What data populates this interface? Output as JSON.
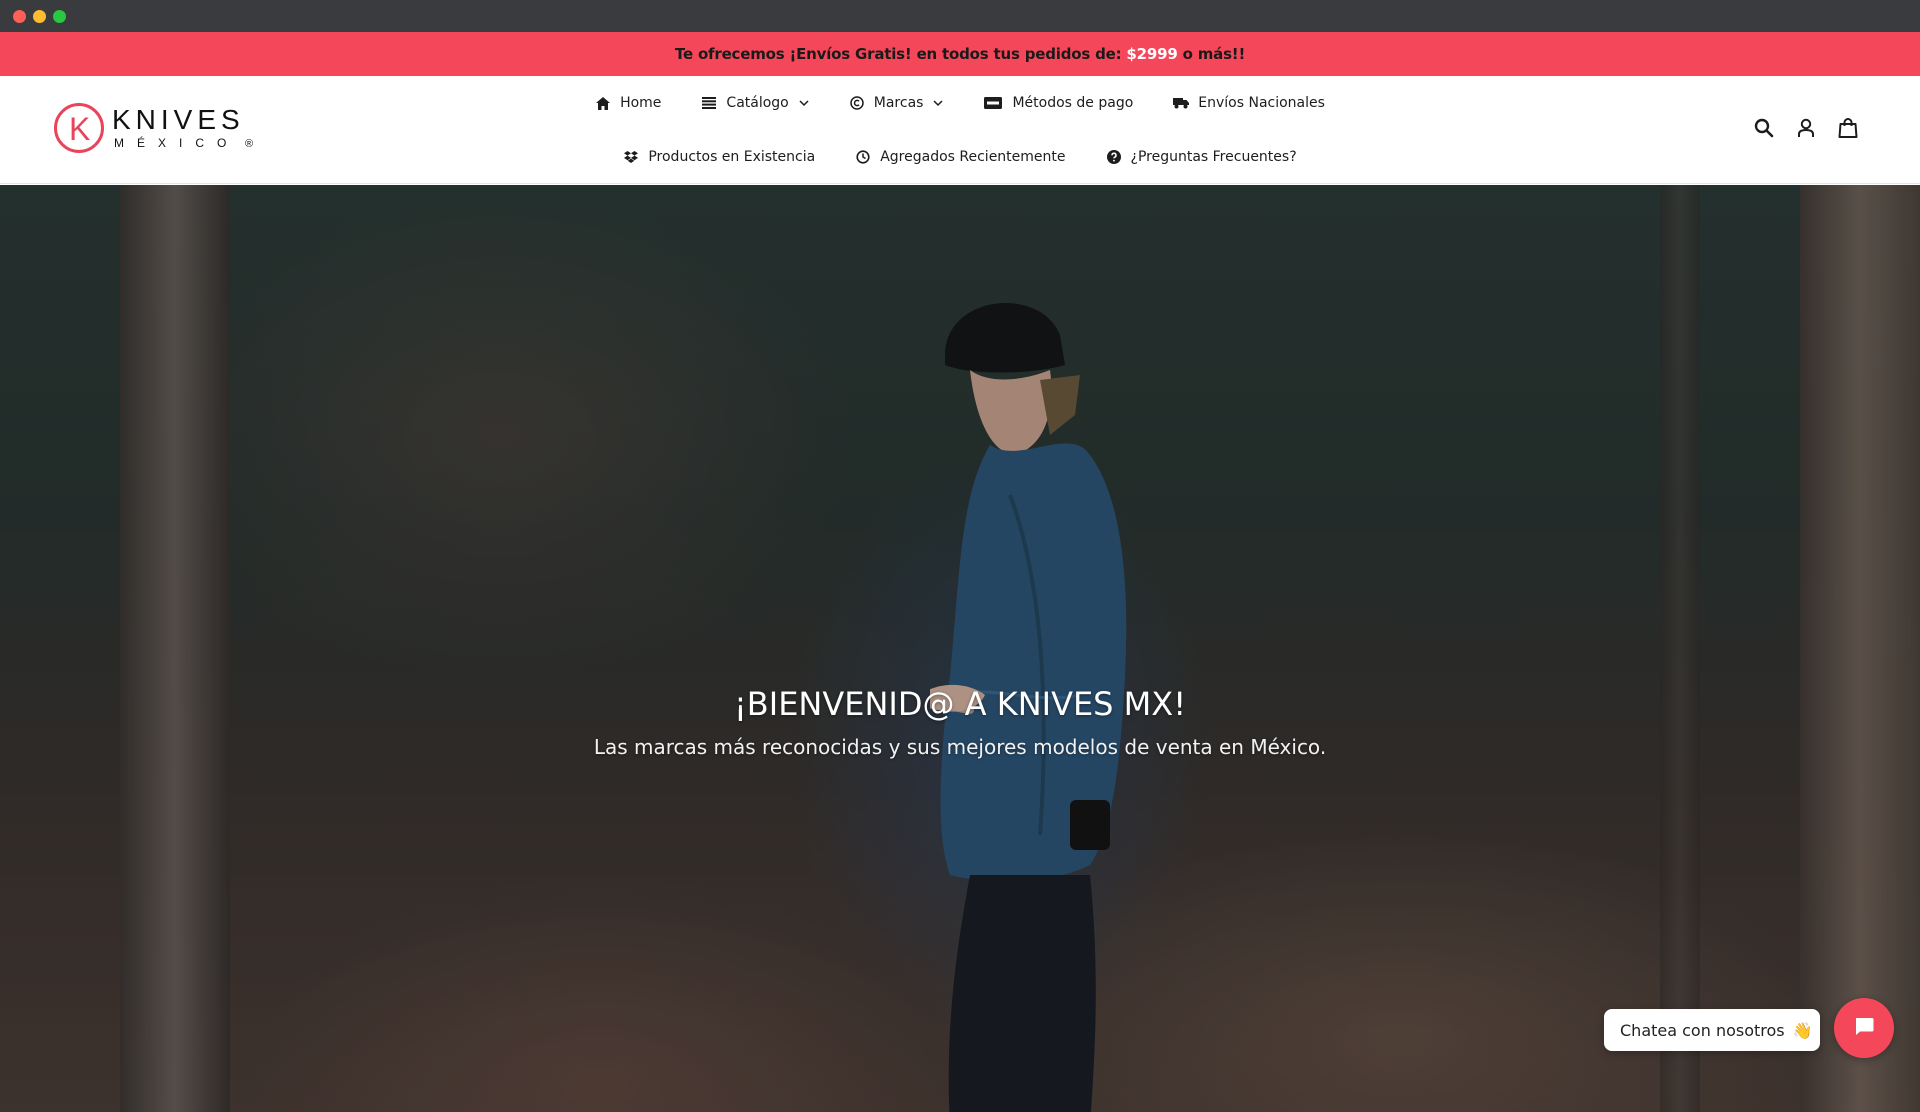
{
  "window": {
    "controls": [
      "close",
      "minimize",
      "maximize"
    ]
  },
  "announcement": {
    "prefix": "Te ofrecemos ¡Envíos Gratis! en todos tus pedidos de:",
    "amount": "$2999",
    "suffix": "o más!!",
    "background": "#f5475a"
  },
  "logo": {
    "mark": "K",
    "word": "KNIVES",
    "sub": "MÉXICO",
    "reg": "®",
    "accent": "#e8455a"
  },
  "nav": {
    "row1": [
      {
        "label": "Home",
        "icon": "home-icon",
        "dropdown": false
      },
      {
        "label": "Catálogo",
        "icon": "list-icon",
        "dropdown": true
      },
      {
        "label": "Marcas",
        "icon": "copyright-icon",
        "dropdown": true
      },
      {
        "label": "Métodos de pago",
        "icon": "visa-card-icon",
        "dropdown": false
      },
      {
        "label": "Envíos Nacionales",
        "icon": "truck-icon",
        "dropdown": false
      }
    ],
    "row2": [
      {
        "label": "Productos en Existencia",
        "icon": "dropbox-icon",
        "dropdown": false
      },
      {
        "label": "Agregados Recientemente",
        "icon": "clock-icon",
        "dropdown": false
      },
      {
        "label": "¿Preguntas Frecuentes?",
        "icon": "question-circle-icon",
        "dropdown": false
      }
    ]
  },
  "header_icons": [
    "search-icon",
    "account-icon",
    "cart-icon"
  ],
  "hero": {
    "title": "¡BIENVENID@ A KNIVES MX!",
    "subtitle": "Las marcas más reconocidas y sus mejores modelos de venta en México."
  },
  "chat": {
    "label": "Chatea con nosotros",
    "emoji": "👋",
    "accent": "#f5475a"
  }
}
